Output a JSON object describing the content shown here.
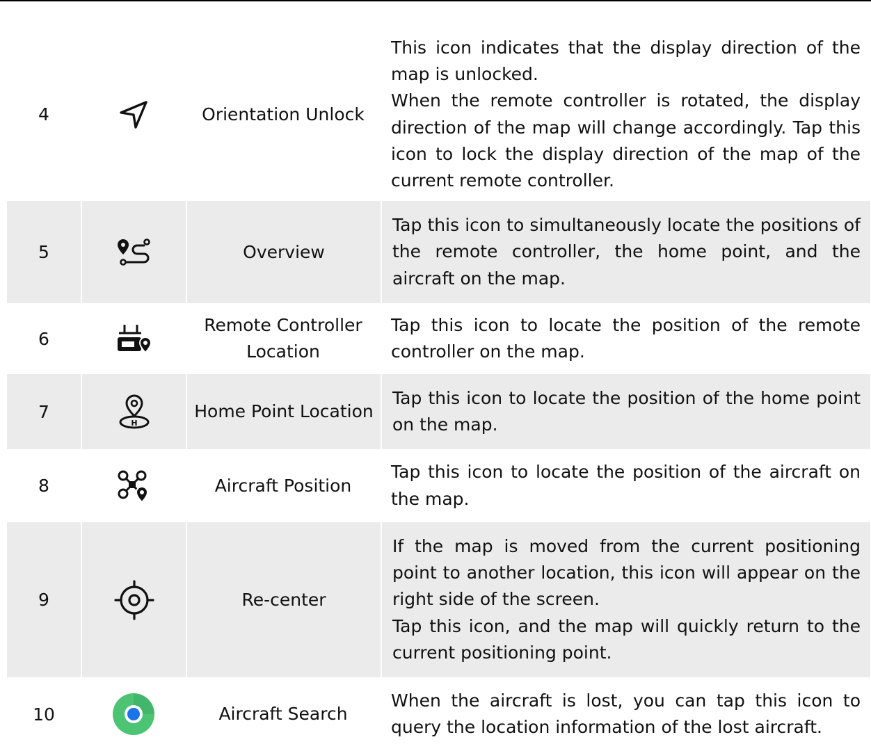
{
  "rows": [
    {
      "num": "4",
      "icon": "navigation-arrow-icon",
      "name": "Orientation Unlock",
      "desc": [
        "This icon indicates that the display direction of the map is unlocked.",
        "When the remote controller is rotated, the display direction of the map will change accordingly. Tap this icon to lock the display direction of the map of the current remote controller."
      ]
    },
    {
      "num": "5",
      "icon": "overview-route-icon",
      "name": "Overview",
      "desc": [
        "Tap this icon to simultaneously locate the positions of the remote controller, the home point, and the aircraft on the map."
      ]
    },
    {
      "num": "6",
      "icon": "remote-controller-location-icon",
      "name": "Remote Controller Location",
      "desc": [
        "Tap this icon to locate the position of the remote controller on the map."
      ]
    },
    {
      "num": "7",
      "icon": "home-point-location-icon",
      "name": "Home Point Location",
      "desc": [
        "Tap this icon to locate the position of the home point on the map."
      ]
    },
    {
      "num": "8",
      "icon": "aircraft-position-icon",
      "name": "Aircraft Position",
      "desc": [
        "Tap this icon to locate the position of the aircraft on the map."
      ]
    },
    {
      "num": "9",
      "icon": "re-center-crosshair-icon",
      "name": "Re-center",
      "desc": [
        "If the map is moved from the current positioning point to another location, this icon will appear on the right side of the screen.",
        "Tap this icon, and the map will quickly return to the current positioning point."
      ]
    },
    {
      "num": "10",
      "icon": "aircraft-search-icon",
      "name": "Aircraft Search",
      "desc": [
        "When the aircraft is lost, you can tap this icon to query the location information of the lost aircraft."
      ]
    }
  ],
  "colors": {
    "row_shade": "#ebebeb",
    "search_green": "#4cc473",
    "search_blue": "#1a73e8"
  }
}
